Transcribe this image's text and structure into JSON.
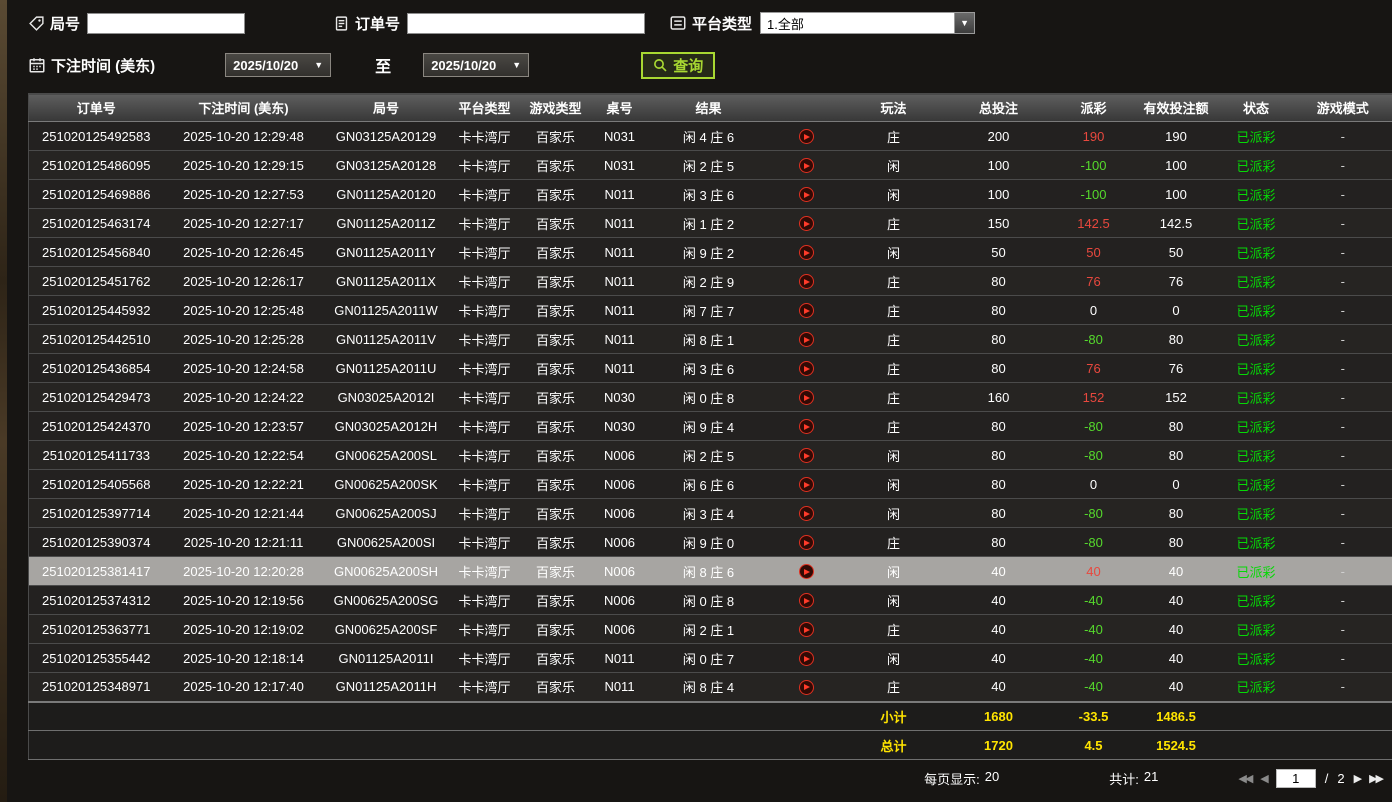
{
  "colors": {
    "payout_win": "#e8483e",
    "payout_loss": "#55d92c",
    "status_paid": "#06d906",
    "summary_yellow": "#ffe400",
    "query_green": "#a8d832",
    "row_highlight": "#a7a5a2"
  },
  "glyphs": {
    "dropdown": "▼",
    "first": "◀◀",
    "prev": "◀",
    "next": "▶",
    "last": "▶▶"
  },
  "filters": {
    "round": {
      "label": "局号",
      "value": ""
    },
    "order": {
      "label": "订单号",
      "value": ""
    },
    "platform": {
      "label": "平台类型",
      "value": "1.全部"
    },
    "bet_time_label": "下注时间 (美东)",
    "date_from": "2025/10/20",
    "date_to": "2025/10/20",
    "to_label": "至",
    "query_label": "查询"
  },
  "table": {
    "columns": [
      "订单号",
      "下注时间 (美东)",
      "局号",
      "平台类型",
      "游戏类型",
      "桌号",
      "结果",
      "",
      "玩法",
      "总投注",
      "派彩",
      "有效投注额",
      "状态",
      "游戏模式"
    ],
    "rows": [
      {
        "order": "251020125492583",
        "time": "2025-10-20 12:29:48",
        "round": "GN03125A20129",
        "platform": "卡卡湾厅",
        "game": "百家乐",
        "table": "N031",
        "result": "闲 4 庄 6",
        "side": "庄",
        "total": "200",
        "payout": "190",
        "payout_class": "win",
        "valid": "190",
        "status": "已派彩",
        "mode": "-"
      },
      {
        "order": "251020125486095",
        "time": "2025-10-20 12:29:15",
        "round": "GN03125A20128",
        "platform": "卡卡湾厅",
        "game": "百家乐",
        "table": "N031",
        "result": "闲 2 庄 5",
        "side": "闲",
        "total": "100",
        "payout": "-100",
        "payout_class": "loss",
        "valid": "100",
        "status": "已派彩",
        "mode": "-"
      },
      {
        "order": "251020125469886",
        "time": "2025-10-20 12:27:53",
        "round": "GN01125A20120",
        "platform": "卡卡湾厅",
        "game": "百家乐",
        "table": "N011",
        "result": "闲 3 庄 6",
        "side": "闲",
        "total": "100",
        "payout": "-100",
        "payout_class": "loss",
        "valid": "100",
        "status": "已派彩",
        "mode": "-"
      },
      {
        "order": "251020125463174",
        "time": "2025-10-20 12:27:17",
        "round": "GN01125A2011Z",
        "platform": "卡卡湾厅",
        "game": "百家乐",
        "table": "N011",
        "result": "闲 1 庄 2",
        "side": "庄",
        "total": "150",
        "payout": "142.5",
        "payout_class": "win",
        "valid": "142.5",
        "status": "已派彩",
        "mode": "-"
      },
      {
        "order": "251020125456840",
        "time": "2025-10-20 12:26:45",
        "round": "GN01125A2011Y",
        "platform": "卡卡湾厅",
        "game": "百家乐",
        "table": "N011",
        "result": "闲 9 庄 2",
        "side": "闲",
        "total": "50",
        "payout": "50",
        "payout_class": "win",
        "valid": "50",
        "status": "已派彩",
        "mode": "-"
      },
      {
        "order": "251020125451762",
        "time": "2025-10-20 12:26:17",
        "round": "GN01125A2011X",
        "platform": "卡卡湾厅",
        "game": "百家乐",
        "table": "N011",
        "result": "闲 2 庄 9",
        "side": "庄",
        "total": "80",
        "payout": "76",
        "payout_class": "win",
        "valid": "76",
        "status": "已派彩",
        "mode": "-"
      },
      {
        "order": "251020125445932",
        "time": "2025-10-20 12:25:48",
        "round": "GN01125A2011W",
        "platform": "卡卡湾厅",
        "game": "百家乐",
        "table": "N011",
        "result": "闲 7 庄 7",
        "side": "庄",
        "total": "80",
        "payout": "0",
        "payout_class": "zero",
        "valid": "0",
        "status": "已派彩",
        "mode": "-"
      },
      {
        "order": "251020125442510",
        "time": "2025-10-20 12:25:28",
        "round": "GN01125A2011V",
        "platform": "卡卡湾厅",
        "game": "百家乐",
        "table": "N011",
        "result": "闲 8 庄 1",
        "side": "庄",
        "total": "80",
        "payout": "-80",
        "payout_class": "loss",
        "valid": "80",
        "status": "已派彩",
        "mode": "-"
      },
      {
        "order": "251020125436854",
        "time": "2025-10-20 12:24:58",
        "round": "GN01125A2011U",
        "platform": "卡卡湾厅",
        "game": "百家乐",
        "table": "N011",
        "result": "闲 3 庄 6",
        "side": "庄",
        "total": "80",
        "payout": "76",
        "payout_class": "win",
        "valid": "76",
        "status": "已派彩",
        "mode": "-"
      },
      {
        "order": "251020125429473",
        "time": "2025-10-20 12:24:22",
        "round": "GN03025A2012I",
        "platform": "卡卡湾厅",
        "game": "百家乐",
        "table": "N030",
        "result": "闲 0 庄 8",
        "side": "庄",
        "total": "160",
        "payout": "152",
        "payout_class": "win",
        "valid": "152",
        "status": "已派彩",
        "mode": "-"
      },
      {
        "order": "251020125424370",
        "time": "2025-10-20 12:23:57",
        "round": "GN03025A2012H",
        "platform": "卡卡湾厅",
        "game": "百家乐",
        "table": "N030",
        "result": "闲 9 庄 4",
        "side": "庄",
        "total": "80",
        "payout": "-80",
        "payout_class": "loss",
        "valid": "80",
        "status": "已派彩",
        "mode": "-"
      },
      {
        "order": "251020125411733",
        "time": "2025-10-20 12:22:54",
        "round": "GN00625A200SL",
        "platform": "卡卡湾厅",
        "game": "百家乐",
        "table": "N006",
        "result": "闲 2 庄 5",
        "side": "闲",
        "total": "80",
        "payout": "-80",
        "payout_class": "loss",
        "valid": "80",
        "status": "已派彩",
        "mode": "-"
      },
      {
        "order": "251020125405568",
        "time": "2025-10-20 12:22:21",
        "round": "GN00625A200SK",
        "platform": "卡卡湾厅",
        "game": "百家乐",
        "table": "N006",
        "result": "闲 6 庄 6",
        "side": "闲",
        "total": "80",
        "payout": "0",
        "payout_class": "zero",
        "valid": "0",
        "status": "已派彩",
        "mode": "-"
      },
      {
        "order": "251020125397714",
        "time": "2025-10-20 12:21:44",
        "round": "GN00625A200SJ",
        "platform": "卡卡湾厅",
        "game": "百家乐",
        "table": "N006",
        "result": "闲 3 庄 4",
        "side": "闲",
        "total": "80",
        "payout": "-80",
        "payout_class": "loss",
        "valid": "80",
        "status": "已派彩",
        "mode": "-"
      },
      {
        "order": "251020125390374",
        "time": "2025-10-20 12:21:11",
        "round": "GN00625A200SI",
        "platform": "卡卡湾厅",
        "game": "百家乐",
        "table": "N006",
        "result": "闲 9 庄 0",
        "side": "庄",
        "total": "80",
        "payout": "-80",
        "payout_class": "loss",
        "valid": "80",
        "status": "已派彩",
        "mode": "-"
      },
      {
        "order": "251020125381417",
        "time": "2025-10-20 12:20:28",
        "round": "GN00625A200SH",
        "platform": "卡卡湾厅",
        "game": "百家乐",
        "table": "N006",
        "result": "闲 8 庄 6",
        "side": "闲",
        "total": "40",
        "payout": "40",
        "payout_class": "win",
        "valid": "40",
        "status": "已派彩",
        "mode": "-",
        "selected": true
      },
      {
        "order": "251020125374312",
        "time": "2025-10-20 12:19:56",
        "round": "GN00625A200SG",
        "platform": "卡卡湾厅",
        "game": "百家乐",
        "table": "N006",
        "result": "闲 0 庄 8",
        "side": "闲",
        "total": "40",
        "payout": "-40",
        "payout_class": "loss",
        "valid": "40",
        "status": "已派彩",
        "mode": "-"
      },
      {
        "order": "251020125363771",
        "time": "2025-10-20 12:19:02",
        "round": "GN00625A200SF",
        "platform": "卡卡湾厅",
        "game": "百家乐",
        "table": "N006",
        "result": "闲 2 庄 1",
        "side": "庄",
        "total": "40",
        "payout": "-40",
        "payout_class": "loss",
        "valid": "40",
        "status": "已派彩",
        "mode": "-"
      },
      {
        "order": "251020125355442",
        "time": "2025-10-20 12:18:14",
        "round": "GN01125A2011I",
        "platform": "卡卡湾厅",
        "game": "百家乐",
        "table": "N011",
        "result": "闲 0 庄 7",
        "side": "闲",
        "total": "40",
        "payout": "-40",
        "payout_class": "loss",
        "valid": "40",
        "status": "已派彩",
        "mode": "-"
      },
      {
        "order": "251020125348971",
        "time": "2025-10-20 12:17:40",
        "round": "GN01125A2011H",
        "platform": "卡卡湾厅",
        "game": "百家乐",
        "table": "N011",
        "result": "闲 8 庄 4",
        "side": "庄",
        "total": "40",
        "payout": "-40",
        "payout_class": "loss",
        "valid": "40",
        "status": "已派彩",
        "mode": "-"
      }
    ]
  },
  "summary": {
    "subtotal": {
      "label": "小计",
      "total": "1680",
      "payout": "-33.5",
      "valid": "1486.5"
    },
    "total": {
      "label": "总计",
      "total": "1720",
      "payout": "4.5",
      "valid": "1524.5"
    }
  },
  "pagination": {
    "per_page_label": "每页显示:",
    "per_page_value": "20",
    "total_label": "共计:",
    "total_value": "21",
    "page": "1",
    "page_separator": "/",
    "page_count": "2"
  }
}
